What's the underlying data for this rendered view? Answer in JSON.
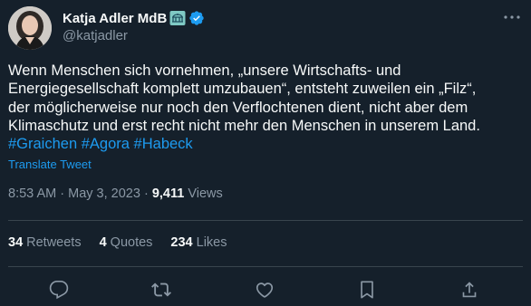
{
  "author": {
    "display_name": "Katja Adler MdB",
    "handle": "@katjadler",
    "badge_icon": "bundestag-emoji-icon",
    "verified_icon": "verified-badge-icon",
    "verified_color": "#1d9bf0"
  },
  "tweet": {
    "lines": [
      "Wenn Menschen sich vornehmen, „unsere Wirtschafts- und",
      "Energiegesellschaft komplett umzubauen“, entsteht zuweilen ein „Filz“,",
      "der möglicherweise nur noch den Verflochtenen dient, nicht aber dem",
      "Klimaschutz und erst recht nicht mehr den Menschen in unserem Land."
    ],
    "hashtags": [
      "#Graichen",
      "#Agora",
      "#Habeck"
    ],
    "translate_label": "Translate Tweet"
  },
  "meta": {
    "time": "8:53 AM",
    "separator": "·",
    "date": "May 3, 2023",
    "views_count": "9,411",
    "views_label": "Views"
  },
  "stats": {
    "retweets_count": "34",
    "retweets_label": "Retweets",
    "quotes_count": "4",
    "quotes_label": "Quotes",
    "likes_count": "234",
    "likes_label": "Likes"
  },
  "actions": [
    "reply-icon",
    "retweet-icon",
    "like-icon",
    "bookmark-icon",
    "share-icon"
  ],
  "colors": {
    "background": "#15202b",
    "text": "#f7f9f9",
    "secondary": "#8b98a5",
    "link": "#1d9bf0",
    "divider": "#38444d"
  }
}
